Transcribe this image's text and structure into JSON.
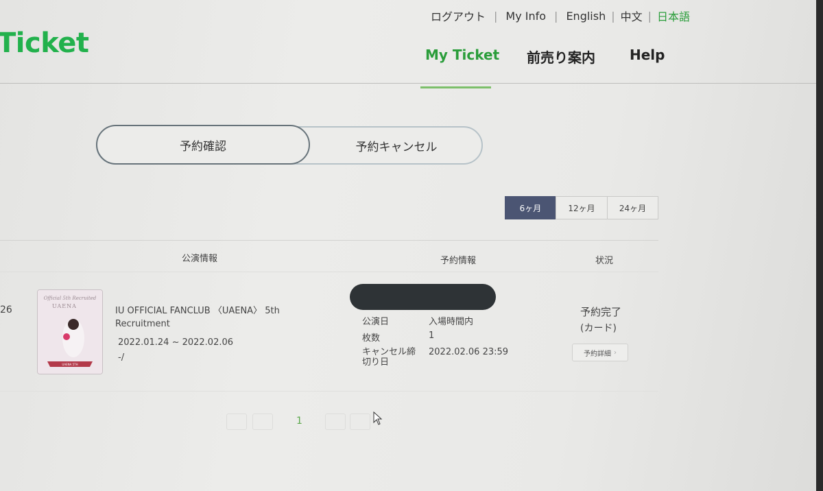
{
  "header": {
    "logo": "Ticket",
    "util_links": [
      "ログアウト",
      "My Info",
      "English",
      "中文",
      "日本語"
    ],
    "active_language": "日本語",
    "nav": [
      "My Ticket",
      "前売り案内",
      "Help"
    ],
    "active_nav": "My Ticket"
  },
  "tabs": {
    "confirm": "予約確認",
    "cancel": "予約キャンセル",
    "active": "予約確認"
  },
  "period": {
    "options": [
      "6ヶ月",
      "12ヶ月",
      "24ヶ月"
    ],
    "selected": "6ヶ月"
  },
  "table": {
    "headers": [
      "公演情報",
      "予約情報",
      "状況"
    ],
    "row": {
      "number": "26",
      "poster_text": "UAENA",
      "title": "IU OFFICIAL FANCLUB 〈UAENA〉 5th Recruitment",
      "dates": "2022.01.24 ~ 2022.02.06",
      "venue": "-/",
      "booking": [
        {
          "label": "公演日",
          "value": "入場時間内"
        },
        {
          "label": "枚数",
          "value": "1"
        },
        {
          "label": "キャンセル締切り日",
          "value": "2022.02.06 23:59"
        }
      ],
      "status": "予約完了",
      "payment": "(カード)",
      "detail_button": "予約詳細"
    }
  },
  "pagination": {
    "current": "1"
  },
  "colors": {
    "brand_green": "#22b14c",
    "period_selected": "#4b5573"
  }
}
